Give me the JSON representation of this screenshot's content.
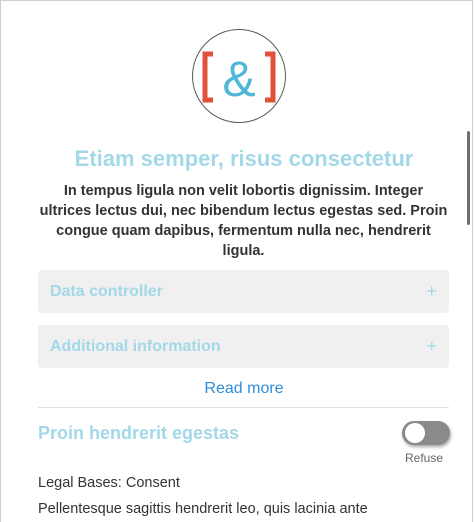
{
  "logo": {
    "glyph": "[&]",
    "bracket_color": "#e0533a",
    "ampersand_color": "#4fb8d6"
  },
  "header": {
    "title": "Etiam semper, risus consectetur",
    "intro": "In tempus ligula non velit lobortis dignissim. Integer ultrices lectus dui, nec bibendum lectus egestas sed. Proin congue quam dapibus, fermentum nulla nec, hendrerit ligula."
  },
  "accordions": [
    {
      "label": "Data controller",
      "icon": "plus-icon",
      "symbol": "+"
    },
    {
      "label": "Additional information",
      "icon": "plus-icon",
      "symbol": "+"
    }
  ],
  "read_more": "Read more",
  "purpose": {
    "title": "Proin hendrerit egestas",
    "toggle_label": "Refuse",
    "toggle_on": false,
    "legal_bases": "Legal Bases: Consent",
    "description": "Pellentesque sagittis hendrerit leo, quis lacinia ante"
  },
  "colors": {
    "accent": "#a3d8e8",
    "link": "#2f8cdb",
    "text": "#333333",
    "panel": "#f0f0f0"
  }
}
